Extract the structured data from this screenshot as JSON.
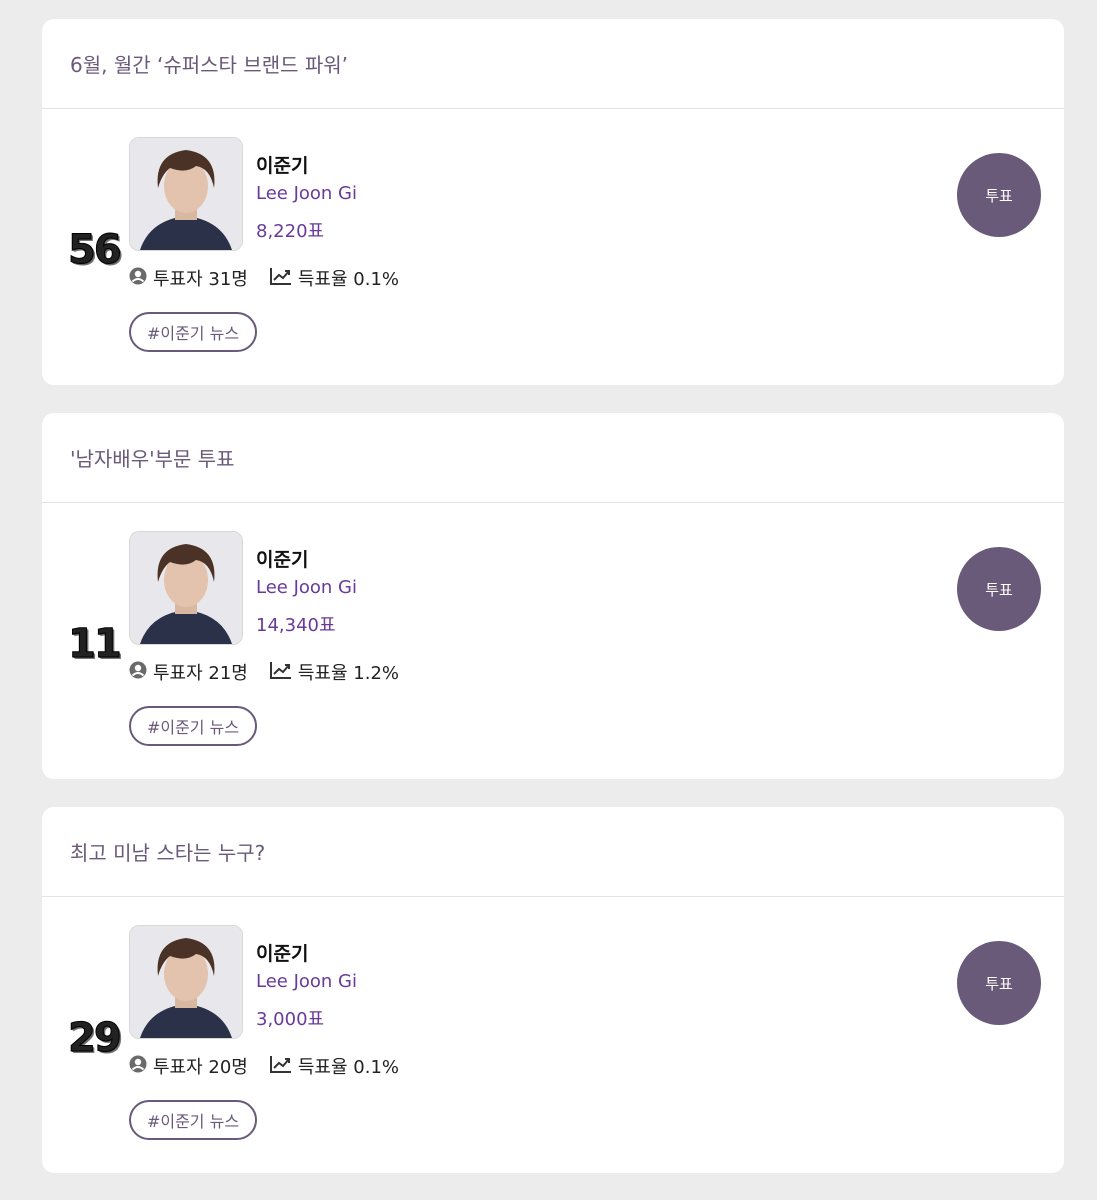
{
  "cards": [
    {
      "title": "6월, 월간 ‘슈퍼스타 브랜드 파워’",
      "rank": "56",
      "name_ko": "이준기",
      "name_en": "Lee Joon Gi",
      "votes": "8,220표",
      "voters": "투표자 31명",
      "rate": "득표율 0.1%",
      "tag": "#이준기 뉴스",
      "vote_label": "투표"
    },
    {
      "title": "'남자배우'부문 투표",
      "rank": "11",
      "name_ko": "이준기",
      "name_en": "Lee Joon Gi",
      "votes": "14,340표",
      "voters": "투표자 21명",
      "rate": "득표율 1.2%",
      "tag": "#이준기 뉴스",
      "vote_label": "투표"
    },
    {
      "title": "최고 미남 스타는 누구?",
      "rank": "29",
      "name_ko": "이준기",
      "name_en": "Lee Joon Gi",
      "votes": "3,000표",
      "voters": "투표자 20명",
      "rate": "득표율 0.1%",
      "tag": "#이준기 뉴스",
      "vote_label": "투표"
    }
  ],
  "colors": {
    "accent": "#6a5a7a",
    "name_en": "#6a3a9a",
    "background": "#ececec"
  },
  "icons": [
    "user-circle-icon",
    "trend-chart-icon"
  ]
}
